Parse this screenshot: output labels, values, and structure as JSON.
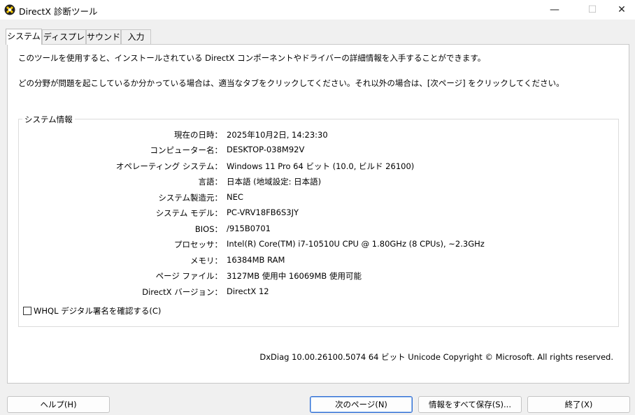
{
  "window": {
    "title": "DirectX 診断ツール",
    "minimize_glyph": "—",
    "maximize_glyph": "☐",
    "close_glyph": "✕"
  },
  "tabs": [
    {
      "label": "システム",
      "active": true
    },
    {
      "label": "ディスプレイ",
      "active": false
    },
    {
      "label": "サウンド",
      "active": false
    },
    {
      "label": "入力",
      "active": false
    }
  ],
  "intro": {
    "line1": "このツールを使用すると、インストールされている DirectX コンポーネントやドライバーの詳細情報を入手することができます。",
    "line2": "どの分野が問題を起こしているか分かっている場合は、適当なタブをクリックしてください。それ以外の場合は、[次ページ] をクリックしてください。"
  },
  "system_info": {
    "title": "システム情報",
    "rows": [
      {
        "label": "現在の日時：",
        "value": "2025年10月2日, 14:23:30"
      },
      {
        "label": "コンピューター名：",
        "value": "DESKTOP-038M92V"
      },
      {
        "label": "オペレーティング システム：",
        "value": "Windows 11 Pro 64 ビット (10.0, ビルド 26100)"
      },
      {
        "label": "言語：",
        "value": "日本語 (地域設定: 日本語)"
      },
      {
        "label": "システム製造元：",
        "value": "NEC"
      },
      {
        "label": "システム モデル：",
        "value": "PC-VRV18FB6S3JY"
      },
      {
        "label": "BIOS：",
        "value": "/915B0701"
      },
      {
        "label": "プロセッサ：",
        "value": "Intel(R) Core(TM) i7-10510U CPU @ 1.80GHz (8 CPUs), ~2.3GHz"
      },
      {
        "label": "メモリ：",
        "value": "16384MB RAM"
      },
      {
        "label": "ページ ファイル：",
        "value": "3127MB 使用中 16069MB 使用可能"
      },
      {
        "label": "DirectX バージョン：",
        "value": "DirectX 12"
      }
    ],
    "whql_label": "WHQL デジタル署名を確認する(C)",
    "whql_checked": false
  },
  "footer": {
    "version_text": "DxDiag 10.00.26100.5074 64 ビット Unicode  Copyright © Microsoft. All rights reserved."
  },
  "buttons": {
    "help": "ヘルプ(H)",
    "next": "次のページ(N)",
    "save": "情報をすべて保存(S)...",
    "exit": "終了(X)"
  },
  "colors": {
    "accent": "#2d6bd3",
    "panel_bg": "#ffffff",
    "window_bg": "#f0f0f0"
  }
}
